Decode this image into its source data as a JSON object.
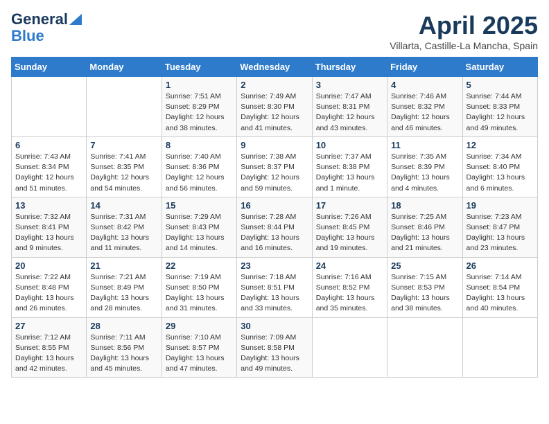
{
  "logo": {
    "line1": "General",
    "line2": "Blue"
  },
  "title": {
    "month_year": "April 2025",
    "location": "Villarta, Castille-La Mancha, Spain"
  },
  "days_of_week": [
    "Sunday",
    "Monday",
    "Tuesday",
    "Wednesday",
    "Thursday",
    "Friday",
    "Saturday"
  ],
  "weeks": [
    [
      {
        "day": "",
        "info": ""
      },
      {
        "day": "",
        "info": ""
      },
      {
        "day": "1",
        "info": "Sunrise: 7:51 AM\nSunset: 8:29 PM\nDaylight: 12 hours and 38 minutes."
      },
      {
        "day": "2",
        "info": "Sunrise: 7:49 AM\nSunset: 8:30 PM\nDaylight: 12 hours and 41 minutes."
      },
      {
        "day": "3",
        "info": "Sunrise: 7:47 AM\nSunset: 8:31 PM\nDaylight: 12 hours and 43 minutes."
      },
      {
        "day": "4",
        "info": "Sunrise: 7:46 AM\nSunset: 8:32 PM\nDaylight: 12 hours and 46 minutes."
      },
      {
        "day": "5",
        "info": "Sunrise: 7:44 AM\nSunset: 8:33 PM\nDaylight: 12 hours and 49 minutes."
      }
    ],
    [
      {
        "day": "6",
        "info": "Sunrise: 7:43 AM\nSunset: 8:34 PM\nDaylight: 12 hours and 51 minutes."
      },
      {
        "day": "7",
        "info": "Sunrise: 7:41 AM\nSunset: 8:35 PM\nDaylight: 12 hours and 54 minutes."
      },
      {
        "day": "8",
        "info": "Sunrise: 7:40 AM\nSunset: 8:36 PM\nDaylight: 12 hours and 56 minutes."
      },
      {
        "day": "9",
        "info": "Sunrise: 7:38 AM\nSunset: 8:37 PM\nDaylight: 12 hours and 59 minutes."
      },
      {
        "day": "10",
        "info": "Sunrise: 7:37 AM\nSunset: 8:38 PM\nDaylight: 13 hours and 1 minute."
      },
      {
        "day": "11",
        "info": "Sunrise: 7:35 AM\nSunset: 8:39 PM\nDaylight: 13 hours and 4 minutes."
      },
      {
        "day": "12",
        "info": "Sunrise: 7:34 AM\nSunset: 8:40 PM\nDaylight: 13 hours and 6 minutes."
      }
    ],
    [
      {
        "day": "13",
        "info": "Sunrise: 7:32 AM\nSunset: 8:41 PM\nDaylight: 13 hours and 9 minutes."
      },
      {
        "day": "14",
        "info": "Sunrise: 7:31 AM\nSunset: 8:42 PM\nDaylight: 13 hours and 11 minutes."
      },
      {
        "day": "15",
        "info": "Sunrise: 7:29 AM\nSunset: 8:43 PM\nDaylight: 13 hours and 14 minutes."
      },
      {
        "day": "16",
        "info": "Sunrise: 7:28 AM\nSunset: 8:44 PM\nDaylight: 13 hours and 16 minutes."
      },
      {
        "day": "17",
        "info": "Sunrise: 7:26 AM\nSunset: 8:45 PM\nDaylight: 13 hours and 19 minutes."
      },
      {
        "day": "18",
        "info": "Sunrise: 7:25 AM\nSunset: 8:46 PM\nDaylight: 13 hours and 21 minutes."
      },
      {
        "day": "19",
        "info": "Sunrise: 7:23 AM\nSunset: 8:47 PM\nDaylight: 13 hours and 23 minutes."
      }
    ],
    [
      {
        "day": "20",
        "info": "Sunrise: 7:22 AM\nSunset: 8:48 PM\nDaylight: 13 hours and 26 minutes."
      },
      {
        "day": "21",
        "info": "Sunrise: 7:21 AM\nSunset: 8:49 PM\nDaylight: 13 hours and 28 minutes."
      },
      {
        "day": "22",
        "info": "Sunrise: 7:19 AM\nSunset: 8:50 PM\nDaylight: 13 hours and 31 minutes."
      },
      {
        "day": "23",
        "info": "Sunrise: 7:18 AM\nSunset: 8:51 PM\nDaylight: 13 hours and 33 minutes."
      },
      {
        "day": "24",
        "info": "Sunrise: 7:16 AM\nSunset: 8:52 PM\nDaylight: 13 hours and 35 minutes."
      },
      {
        "day": "25",
        "info": "Sunrise: 7:15 AM\nSunset: 8:53 PM\nDaylight: 13 hours and 38 minutes."
      },
      {
        "day": "26",
        "info": "Sunrise: 7:14 AM\nSunset: 8:54 PM\nDaylight: 13 hours and 40 minutes."
      }
    ],
    [
      {
        "day": "27",
        "info": "Sunrise: 7:12 AM\nSunset: 8:55 PM\nDaylight: 13 hours and 42 minutes."
      },
      {
        "day": "28",
        "info": "Sunrise: 7:11 AM\nSunset: 8:56 PM\nDaylight: 13 hours and 45 minutes."
      },
      {
        "day": "29",
        "info": "Sunrise: 7:10 AM\nSunset: 8:57 PM\nDaylight: 13 hours and 47 minutes."
      },
      {
        "day": "30",
        "info": "Sunrise: 7:09 AM\nSunset: 8:58 PM\nDaylight: 13 hours and 49 minutes."
      },
      {
        "day": "",
        "info": ""
      },
      {
        "day": "",
        "info": ""
      },
      {
        "day": "",
        "info": ""
      }
    ]
  ]
}
